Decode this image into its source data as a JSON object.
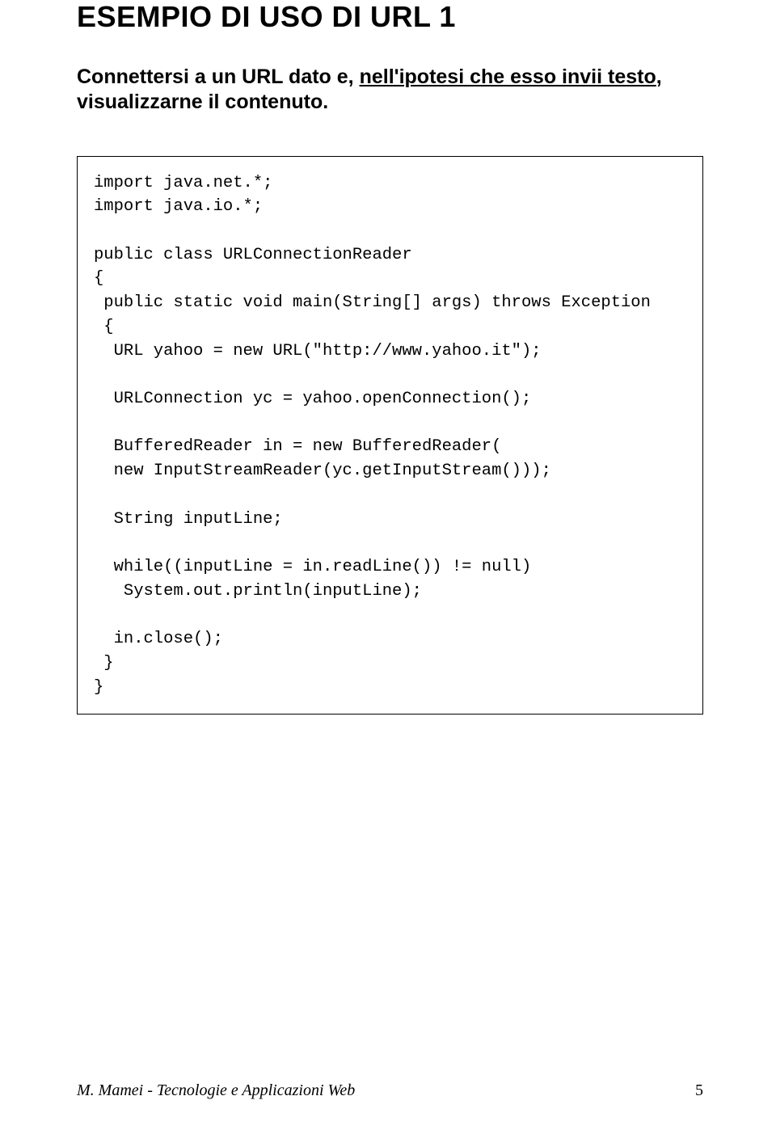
{
  "title": "ESEMPIO DI USO DI URL 1",
  "intro": {
    "part1": "Connettersi a un URL dato e, ",
    "underlined1": "nell'ipotesi che esso invii testo",
    "part2": ", visualizzarne il contenuto."
  },
  "code": "import java.net.*;\nimport java.io.*;\n\npublic class URLConnectionReader\n{\n public static void main(String[] args) throws Exception\n {\n  URL yahoo = new URL(\"http://www.yahoo.it\");\n\n  URLConnection yc = yahoo.openConnection();\n\n  BufferedReader in = new BufferedReader(\n  new InputStreamReader(yc.getInputStream()));\n\n  String inputLine;\n\n  while((inputLine = in.readLine()) != null)\n   System.out.println(inputLine);\n\n  in.close();\n }\n}",
  "footer": {
    "left": "M. Mamei - Tecnologie e Applicazioni Web",
    "right": "5"
  }
}
